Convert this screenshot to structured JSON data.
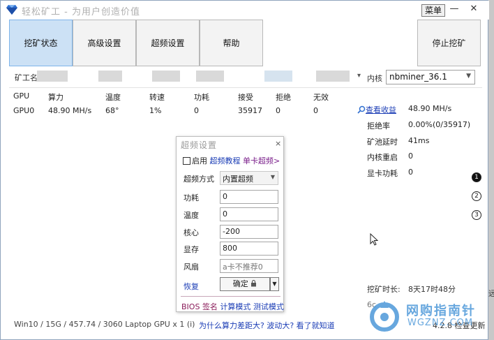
{
  "window": {
    "title": "轻松矿工 - 为用户创造价值",
    "menu_label": "菜单",
    "minimize": "—",
    "close": "✕"
  },
  "tabs": [
    {
      "label": "挖矿状态",
      "active": true
    },
    {
      "label": "高级设置",
      "active": false
    },
    {
      "label": "超频设置",
      "active": false
    },
    {
      "label": "帮助",
      "active": false
    }
  ],
  "stop_button": "停止挖矿",
  "worker": {
    "label": "矿工名"
  },
  "kernel": {
    "label": "内核",
    "value": "nbminer_36.1"
  },
  "gpu_table": {
    "headers": [
      "GPU",
      "算力",
      "温度",
      "转速",
      "功耗",
      "接受",
      "拒绝",
      "无效"
    ],
    "rows": [
      [
        "GPU0",
        "48.90 MH/s",
        "68°",
        "1%",
        "0",
        "35917",
        "0",
        "0"
      ]
    ]
  },
  "stats": {
    "view_earnings": "查看收益",
    "hashrate": "48.90 MH/s",
    "reject_rate_label": "拒绝率",
    "reject_rate": "0.00%(0/35917)",
    "pool_latency_label": "矿池延时",
    "pool_latency": "41ms",
    "kernel_restart_label": "内核重启",
    "kernel_restart": "0",
    "gpu_power_label": "显卡功耗",
    "gpu_power": "0"
  },
  "markers": [
    "1",
    "2",
    "3"
  ],
  "overclock": {
    "title": "超频设置",
    "close": "×",
    "enable_label": "启用",
    "tutorial_link": "超频教程",
    "single_card_link": "单卡超频>",
    "mode_label": "超频方式",
    "mode_value": "内置超频",
    "power_label": "功耗",
    "power_value": "0",
    "temp_label": "温度",
    "temp_value": "0",
    "core_label": "核心",
    "core_value": "-200",
    "memory_label": "显存",
    "memory_value": "800",
    "fan_label": "风扇",
    "fan_placeholder": "a卡不推荐0",
    "restore": "恢复",
    "confirm": "确定",
    "footer_bios": "BIOS",
    "footer_sign": "签名",
    "footer_compute": "计算模式",
    "footer_test": "测试模式"
  },
  "mining_time": {
    "label": "挖矿时长:",
    "value": "8天17时48分"
  },
  "partial_text": "6c",
  "edge_text": "远",
  "statusbar": {
    "info": "Win10  / 15G / 457.74 / 3060 Laptop GPU x 1 (i)",
    "link": "为什么算力差距大? 波动大? 看了就知道",
    "version": "4.2.8 检查更新"
  },
  "watermark": {
    "title": "网购指南针",
    "subtitle": "WGZNZ.COM"
  },
  "colors": {
    "tab_active": "#cce1f5",
    "link": "#1a3cb5",
    "footer_accent": "#8a1c5a",
    "watermark": "#3d8fd6"
  }
}
